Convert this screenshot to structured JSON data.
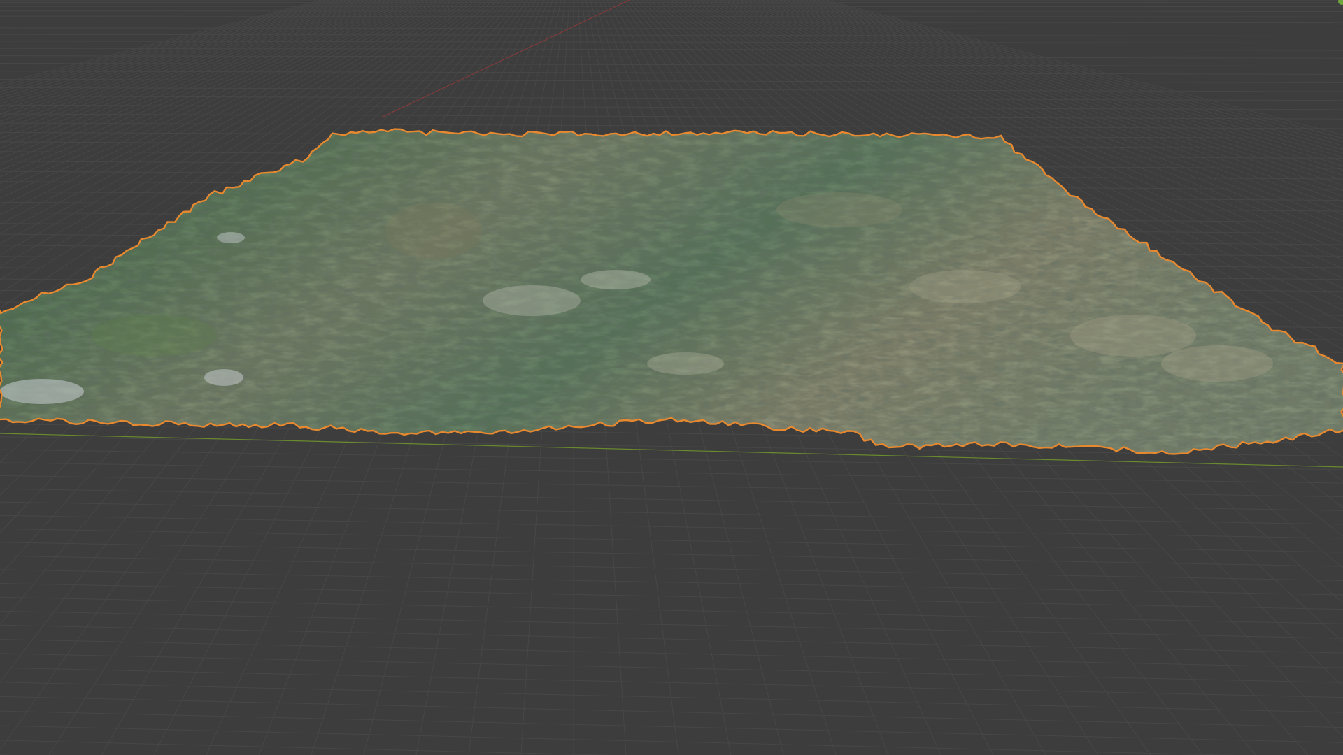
{
  "app": "3D viewport",
  "scene": {
    "object": "terrain-mesh",
    "selected": true,
    "view": "perspective"
  },
  "colors": {
    "background": "#3d3d3d",
    "grid": "#4a4a4a",
    "x_axis": "#8a3a3a",
    "y_axis": "#6a8a2e",
    "selection_outline": "#e8892f",
    "terrain_green": "#4d6a4a",
    "terrain_tan": "#8a8468",
    "snow": "#c9cdd3"
  }
}
